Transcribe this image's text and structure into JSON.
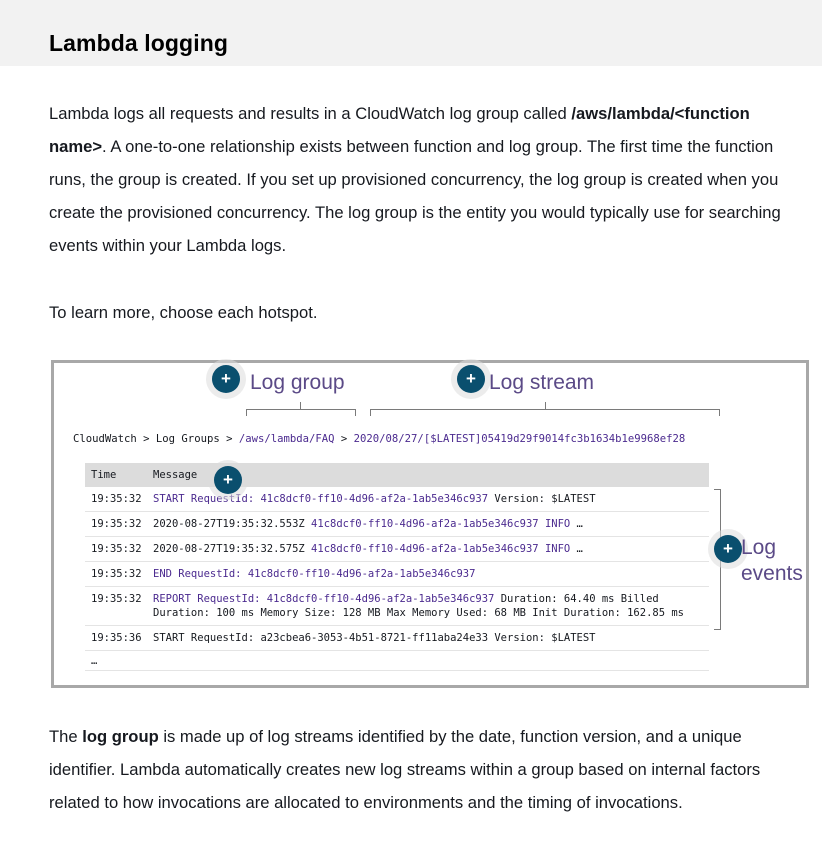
{
  "title": "Lambda logging",
  "paragraph1": {
    "t1": "Lambda logs all requests and results in a CloudWatch log group called ",
    "b1": "/aws/lambda/<function name>",
    "t2": ". A one-to-one relationship exists between function and log group. The first time the function runs, the group is created. If you set up provisioned concurrency, the log group is created when you create the provisioned concurrency. The log group is the entity you would typically use for searching events within your Lambda logs."
  },
  "paragraph2": "To learn more, choose each hotspot.",
  "figure": {
    "hotspot_symbol": "+",
    "labels": {
      "log_group": "Log group",
      "log_stream": "Log stream",
      "log_events_1": "Log",
      "log_events_2": "events"
    },
    "breadcrumb": {
      "cloudwatch": "CloudWatch",
      "sep": " > ",
      "log_groups": "Log Groups",
      "group": "/aws/lambda/FAQ",
      "stream": "2020/08/27/[$LATEST]05419d29f9014fc3b1634b1e9968ef28"
    },
    "columns": {
      "time": "Time",
      "message": "Message"
    },
    "rows": [
      {
        "time": "19:35:32",
        "a": "START RequestId: ",
        "b": "41c8dcf0-ff10-4d96-af2a-1ab5e346c937",
        "c": " Version: $LATEST",
        "d": ""
      },
      {
        "time": "19:35:32",
        "a": "2020-08-27T19:35:32.553Z ",
        "b": "41c8dcf0-ff10-4d96-af2a-1ab5e346c937 INFO",
        "c": " …",
        "d": ""
      },
      {
        "time": "19:35:32",
        "a": "2020-08-27T19:35:32.575Z ",
        "b": "41c8dcf0-ff10-4d96-af2a-1ab5e346c937 INFO",
        "c": " …",
        "d": ""
      },
      {
        "time": "19:35:32",
        "a": "END RequestId: ",
        "b": "41c8dcf0-ff10-4d96-af2a-1ab5e346c937",
        "c": "",
        "d": ""
      },
      {
        "time": "19:35:32",
        "a": "REPORT RequestId: ",
        "b": "41c8dcf0-ff10-4d96-af2a-1ab5e346c937",
        "c": " Duration: 64.40 ms Billed Duration: 100 ms Memory Size: 128 MB Max Memory Used: 68 MB Init Duration: 162.85 ms",
        "d": ""
      },
      {
        "time": "19:35:36",
        "a": "",
        "b": "",
        "c": "START RequestId: a23cbea6-3053-4b51-8721-ff11aba24e33 Version: $LATEST",
        "d": ""
      }
    ],
    "ellipsis": "…"
  },
  "paragraph3": {
    "t1": "The ",
    "b1": "log group",
    "t2": " is made up of log streams identified by the date, function version, and a unique identifier. Lambda automatically creates new log streams within a group based on internal factors related to how invocations are allocated to environments and the timing of invocations."
  },
  "colors": {
    "hotspot": "#0a4f6e",
    "label": "#5b4a87",
    "link": "#4b2a8f",
    "header_band": "#f2f2f2"
  }
}
